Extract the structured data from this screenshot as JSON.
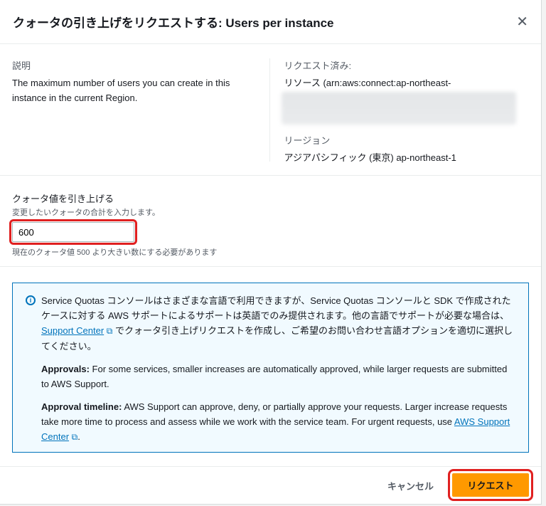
{
  "dialog": {
    "title": "クォータの引き上げをリクエストする: Users per instance"
  },
  "description": {
    "label": "説明",
    "text": "The maximum number of users you can create in this instance in the current Region."
  },
  "requested": {
    "label": "リクエスト済み:",
    "resource": "リソース (arn:aws:connect:ap-northeast-",
    "region_label": "リージョン",
    "region": "アジアパシフィック (東京) ap-northeast-1"
  },
  "quota_input": {
    "label": "クォータ値を引き上げる",
    "description": "変更したいクォータの合計を入力します。",
    "value": "600",
    "constraint": "現在のクォータ値 500 より大きい数にする必要があります"
  },
  "alert": {
    "p1_a": "Service Quotas コンソールはさまざまな言語で利用できますが、Service Quotas コンソールと SDK で作成されたケースに対する AWS サポートによるサポートは英語でのみ提供されます。他の言語でサポートが必要な場合は、",
    "p1_link": "Support Center",
    "p1_b": " でクォータ引き上げリクエストを作成し、ご希望のお問い合わせ言語オプションを適切に選択してください。",
    "p2_bold": "Approvals:",
    "p2": " For some services, smaller increases are automatically approved, while larger requests are submitted to AWS Support.",
    "p3_bold": "Approval timeline:",
    "p3": " AWS Support can approve, deny, or partially approve your requests. Larger increase requests take more time to process and assess while we work with the service team. For urgent requests, use ",
    "p3_link": "AWS Support Center",
    "p3_end": "."
  },
  "footer": {
    "cancel": "キャンセル",
    "submit": "リクエスト"
  }
}
